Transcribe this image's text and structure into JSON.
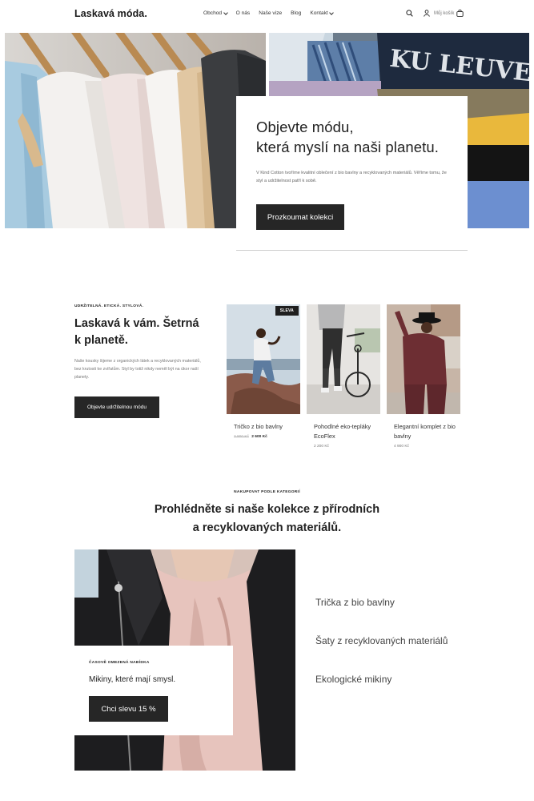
{
  "header": {
    "logo": "Laskavá móda.",
    "nav": [
      {
        "label": "Obchod",
        "dropdown": true
      },
      {
        "label": "O nás",
        "dropdown": false
      },
      {
        "label": "Naše vize",
        "dropdown": false
      },
      {
        "label": "Blog",
        "dropdown": false
      },
      {
        "label": "Kontakt",
        "dropdown": true
      }
    ],
    "cart_label": "Můj košík",
    "icons": [
      "search-icon",
      "user-icon",
      "cart-icon"
    ]
  },
  "hero": {
    "title_line1": "Objevte módu,",
    "title_line2": "která myslí na naši planetu.",
    "text": "V Kind Cotton tvoříme kvalitní oblečení z bio bavlny a recyklovaných materiálů. Věříme tomu, že styl a udržitelnost patří k sobě.",
    "button": "Prozkoumat kolekci",
    "right_image_text": "KU LEUVEN"
  },
  "sustainable": {
    "kicker": "UDRŽITELNÁ. ETICKÁ. STYLOVÁ.",
    "title_line1": "Laskavá k vám. Šetrná",
    "title_line2": "k planetě.",
    "text": "Naše kousky šijeme z organických látek a recyklovaných materiálů, bez krutosti ke zvířatům. Styl by totiž nikdy neměl být na úkor naší planety.",
    "button": "Objevte udržitelnou módu"
  },
  "products": [
    {
      "name": "Tričko z bio bavlny",
      "old_price": "3 900 Kč",
      "price": "2 600 Kč",
      "badge": "SLEVA"
    },
    {
      "name": "Pohodlné eko-tepláky EcoFlex",
      "old_price": "",
      "price": "2 200 Kč",
      "badge": ""
    },
    {
      "name": "Elegantní komplet z bio bavlny",
      "old_price": "",
      "price": "4 900 Kč",
      "badge": ""
    }
  ],
  "categories": {
    "kicker": "NAKUPOVAT PODLE KATEGORIÍ",
    "title_line1": "Prohlédněte si naše kolekce z přírodních",
    "title_line2": "a recyklovaných materiálů.",
    "offer": {
      "kicker": "ČASOVĚ OMEZENÁ NABÍDKA",
      "title": "Mikiny, které mají smysl.",
      "button": "Chci slevu 15 %"
    },
    "links": [
      "Trička z bio bavlny",
      "Šaty z recyklovaných materiálů",
      "Ekologické mikiny"
    ]
  },
  "colors": {
    "button_bg": "#262626",
    "text": "#222222",
    "muted": "#777777"
  }
}
